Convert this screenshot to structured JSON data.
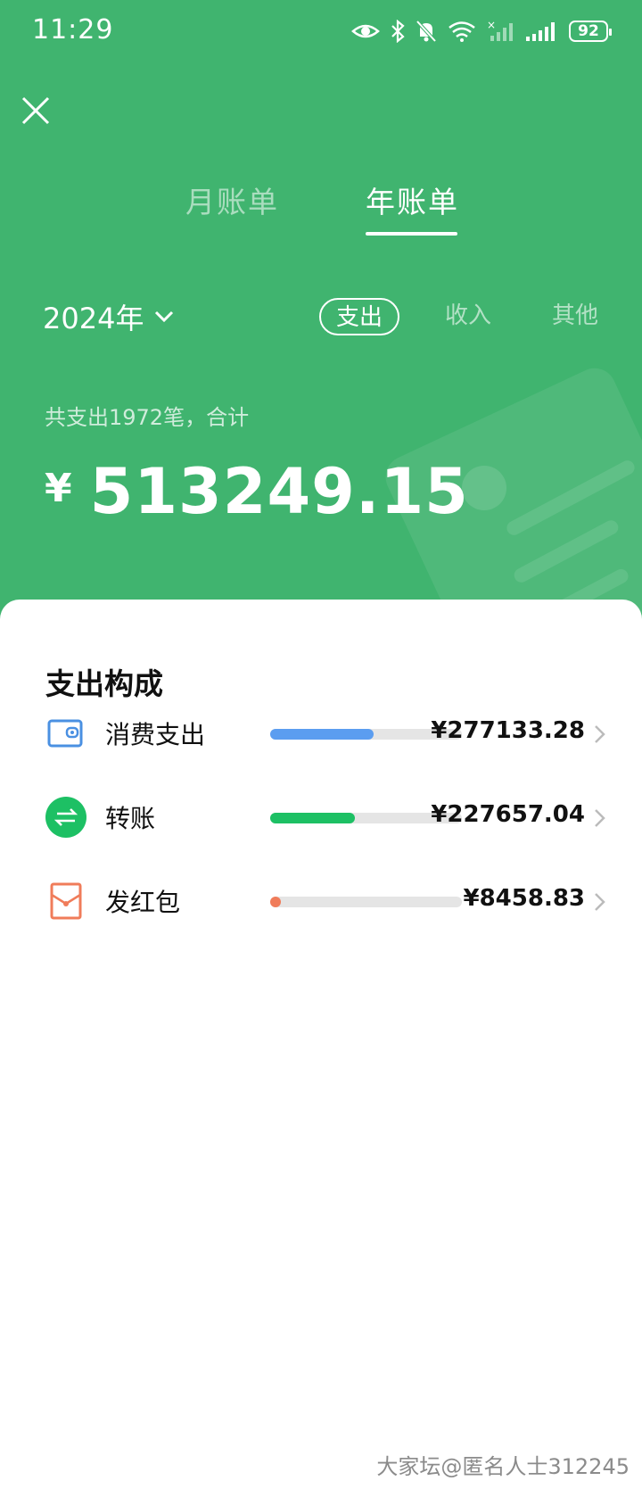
{
  "status_bar": {
    "time": "11:29",
    "battery": "92"
  },
  "tabs": [
    {
      "label": "月账单",
      "active": false
    },
    {
      "label": "年账单",
      "active": true
    }
  ],
  "year_selector": {
    "label": "2024年"
  },
  "filters": [
    "支出",
    "收入",
    "其他"
  ],
  "summary": {
    "label": "共支出1972笔，合计",
    "currency": "¥",
    "total": "513249.15"
  },
  "breakdown": {
    "title": "支出构成",
    "items": [
      {
        "label": "消费支出",
        "amount": "¥277133.28",
        "ratio": 0.54,
        "color": "#5b9df0",
        "icon": "wallet-icon"
      },
      {
        "label": "转账",
        "amount": "¥227657.04",
        "ratio": 0.44,
        "color": "#1dc064",
        "icon": "transfer-icon"
      },
      {
        "label": "发红包",
        "amount": "¥8458.83",
        "ratio": 0.017,
        "color": "#f07c5a",
        "icon": "red-packet-icon"
      }
    ]
  },
  "watermark": "大家坛@匿名人士312245",
  "colors": {
    "header_green": "#40b46f"
  }
}
